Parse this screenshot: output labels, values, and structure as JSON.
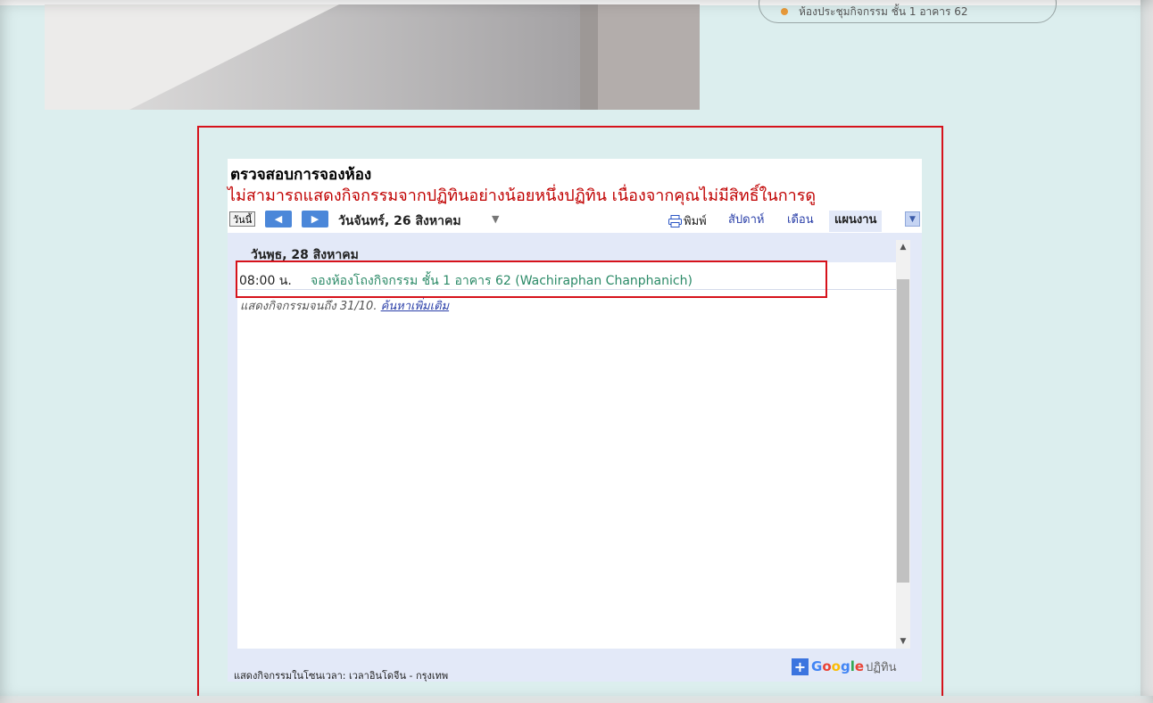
{
  "top_pill": {
    "text": "ห้องประชุมกิจกรรม ชั้น 1 อาคาร 62"
  },
  "calendar": {
    "title": "ตรวจสอบการจองห้อง",
    "error": "ไม่สามารถแสดงกิจกรรมจากปฏิทินอย่างน้อยหนึ่งปฏิทิน เนื่องจากคุณไม่มีสิทธิ์ในการดู",
    "toolbar": {
      "today_label": "วันนี้",
      "prev_icon": "chevron-left-icon",
      "next_icon": "chevron-right-icon",
      "date_label": "วันจันทร์, 26 สิงหาคม",
      "print_label": "พิมพ์",
      "tabs": [
        {
          "label": "สัปดาห์",
          "active": false
        },
        {
          "label": "เดือน",
          "active": false
        },
        {
          "label": "แผนงาน",
          "active": true
        }
      ]
    },
    "agenda": {
      "day_header": "วันพุธ, 28 สิงหาคม",
      "events": [
        {
          "time": "08:00 น.",
          "title": "จองห้องโถงกิจกรรม ชั้น 1 อาคาร 62 (Wachiraphan Chanphanich)"
        }
      ],
      "more_text": "แสดงกิจกรรมจนถึง 31/10.",
      "more_link": "ค้นหาเพิ่มเติม"
    },
    "footer": {
      "timezone": "แสดงกิจกรรมในโซนเวลา: เวลาอินโดจีน - กรุงเทพ",
      "brand_google": "Google",
      "brand_calendar": "ปฏิทิน"
    }
  },
  "colors": {
    "page_bg": "#dceeee",
    "highlight_red": "#d6121b",
    "event_green": "#2b8a67",
    "link_blue": "#2a3fa8",
    "nav_blue": "#4b87d9",
    "panel_bg": "#e3e9f8"
  }
}
